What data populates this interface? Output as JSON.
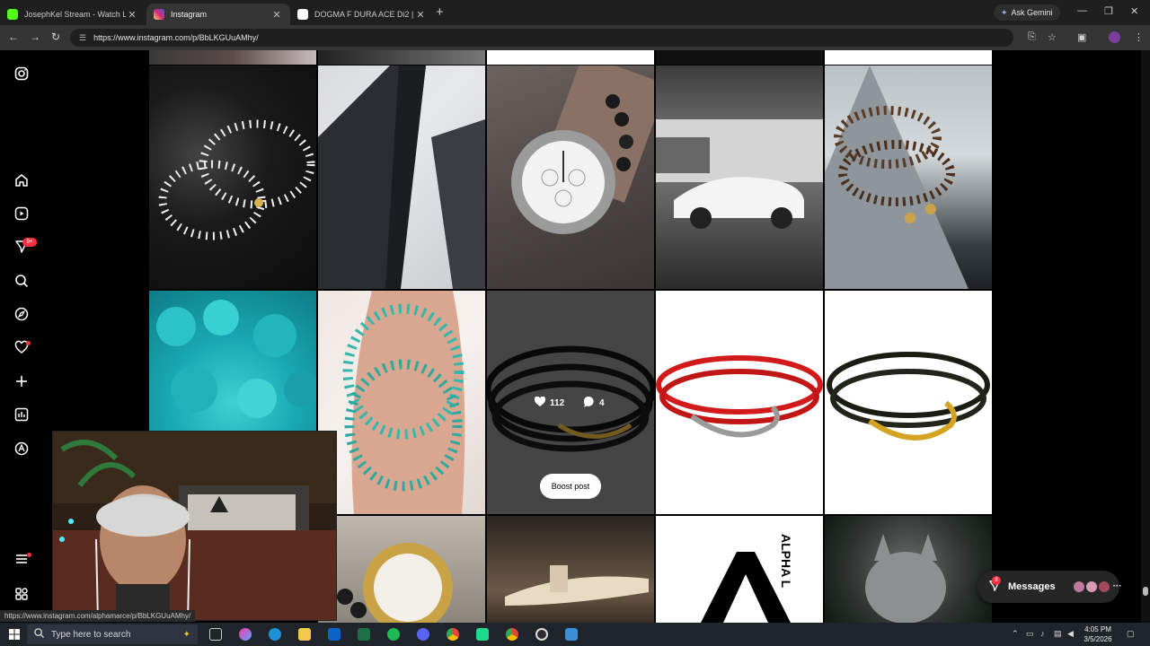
{
  "browser": {
    "tabs": [
      {
        "title": "JosephKel Stream - Watch Live",
        "favicon_color": "#53fc18",
        "active": false
      },
      {
        "title": "Instagram",
        "favicon_color": "#d62976",
        "active": true
      },
      {
        "title": "DOGMA F DURA ACE Di2 | en |",
        "favicon_color": "#ffffff",
        "active": false
      }
    ],
    "new_tab": "+",
    "gemini_label": "Ask Gemini",
    "url": "https://www.instagram.com/p/BbLKGUuAMhy/",
    "status_url": "https://www.instagram.com/alphamarce/p/BbLKGUuAMhy/"
  },
  "instagram": {
    "nav_items": [
      "instagram-logo-icon",
      "home-icon",
      "reels-icon",
      "messenger-icon",
      "search-icon",
      "explore-icon",
      "notifications-icon",
      "create-icon",
      "dashboard-icon",
      "threads-icon",
      "menu-icon",
      "meta-apps-icon"
    ],
    "notification_badge": "9+",
    "hover_post": {
      "likes": "112",
      "comments": "4",
      "boost_label": "Boost post"
    },
    "grid": [
      {
        "name": "black-stones-bracelet",
        "label": "White bead bracelet on black stones"
      },
      {
        "name": "skyscraper",
        "label": "Dark skyscrapers"
      },
      {
        "name": "watch-on-wrist",
        "label": "Audemars Piguet watch with bead bracelet"
      },
      {
        "name": "white-ferrari",
        "label": "White Ferrari at Lamborghini service"
      },
      {
        "name": "wood-bead-bracelets",
        "label": "Wood bead bracelets on concrete cone"
      },
      {
        "name": "turquoise-beads",
        "label": "Turquoise beads close up"
      },
      {
        "name": "turquoise-bracelet-hand",
        "label": "Turquoise bracelet on hand"
      },
      {
        "name": "black-rope-hook",
        "label": "Black rope hook bracelet"
      },
      {
        "name": "red-rope-hook",
        "label": "Red rope hook bracelet"
      },
      {
        "name": "black-rope-gold-hook",
        "label": "Black rope gold hook bracelet"
      },
      {
        "name": "gold-rolex",
        "label": "Gold Rolex watch"
      },
      {
        "name": "private-jet",
        "label": "Private jet at night"
      },
      {
        "name": "alpha-logo",
        "label": "Alpha logo"
      },
      {
        "name": "wolf",
        "label": "Wolf in the dark"
      }
    ],
    "messages": {
      "label": "Messages",
      "badge": "8"
    }
  },
  "taskbar": {
    "search_placeholder": "Type here to search",
    "time": "4:05 PM",
    "date": "3/5/2026"
  }
}
